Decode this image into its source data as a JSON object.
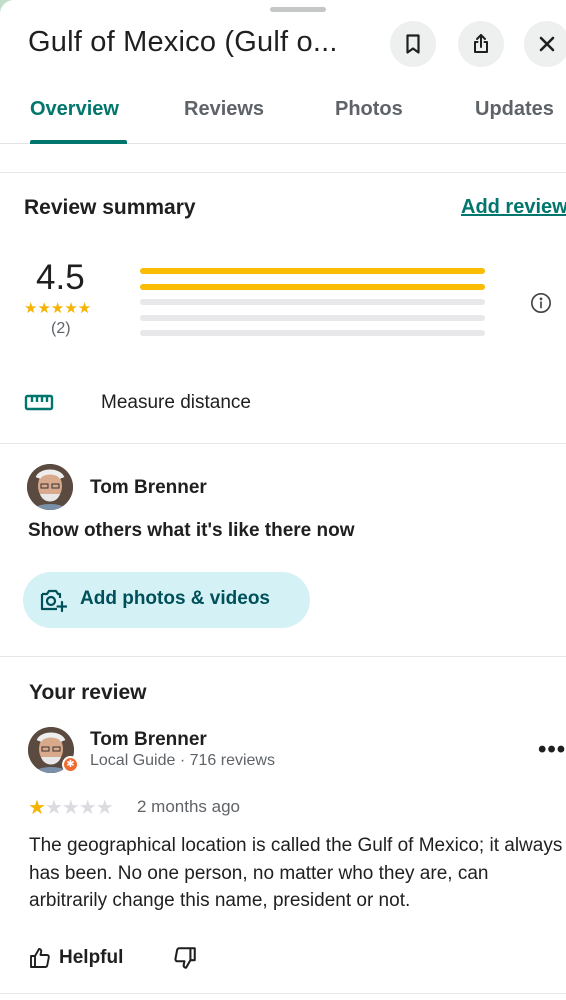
{
  "place": {
    "title": "Gulf of Mexico (Gulf o..."
  },
  "header_actions": {
    "save_icon": "bookmark-icon",
    "share_icon": "share-icon",
    "close_icon": "close-icon"
  },
  "tabs": [
    {
      "label": "Overview",
      "active": true
    },
    {
      "label": "Reviews",
      "active": false
    },
    {
      "label": "Photos",
      "active": false
    },
    {
      "label": "Updates",
      "active": false
    }
  ],
  "review_summary": {
    "title": "Review summary",
    "add_review_label": "Add review",
    "average": "4.5",
    "average_stars": "★★★★★",
    "count": "(2)",
    "distribution": [
      {
        "stars": 5,
        "fraction": 1.0
      },
      {
        "stars": 4,
        "fraction": 1.0
      },
      {
        "stars": 3,
        "fraction": 0.0
      },
      {
        "stars": 2,
        "fraction": 0.0
      },
      {
        "stars": 1,
        "fraction": 0.0
      }
    ]
  },
  "measure": {
    "label": "Measure distance"
  },
  "contribute": {
    "user_name": "Tom Brenner",
    "prompt": "Show others what it's like there now",
    "add_photos_label": "Add photos & videos"
  },
  "your_review": {
    "title": "Your review",
    "user_name": "Tom Brenner",
    "meta": "Local Guide · 716 reviews",
    "rating": 1,
    "rating_stars_on": "★",
    "rating_stars_off": "★★★★",
    "time": "2 months ago",
    "text": "The geographical location is called the Gulf of Mexico; it always has been. No one person, no matter who they are, can arbitrarily change this name, president or not.",
    "helpful_label": "Helpful",
    "more_label": "•••"
  },
  "colors": {
    "accent": "#00766c",
    "star": "#fbbc04",
    "chip_bg": "#d4f1f6",
    "guide_badge": "#f06b2d"
  }
}
